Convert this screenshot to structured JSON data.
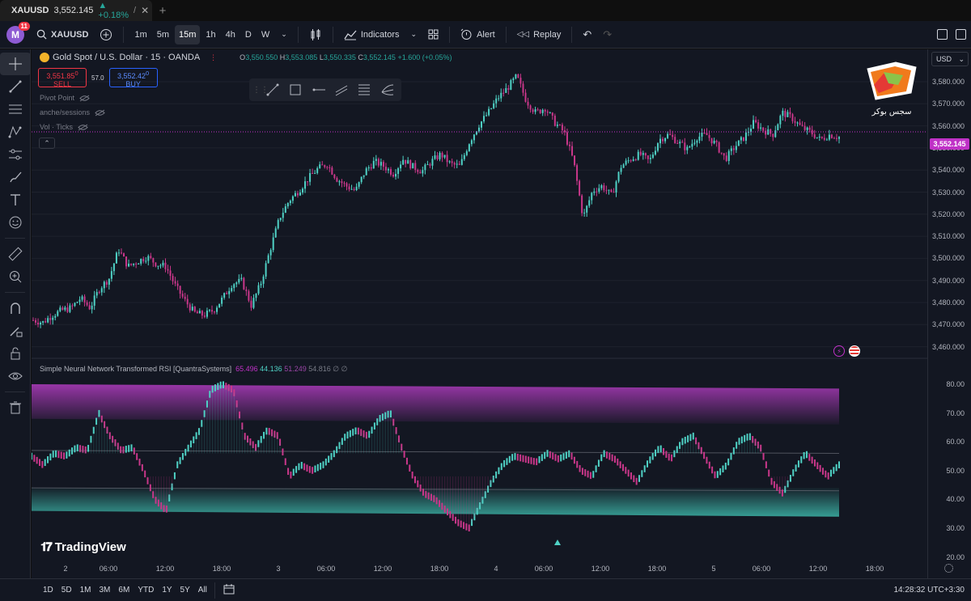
{
  "browser": {
    "tab_title": "XAUUSD",
    "tab_price": "3,552.145",
    "tab_change": "▲ +0.18%",
    "tab_suffix": "/"
  },
  "toolbar": {
    "avatar_letter": "M",
    "notification_count": "11",
    "symbol": "XAUUSD",
    "timeframes": [
      "1m",
      "5m",
      "15m",
      "1h",
      "4h",
      "D",
      "W"
    ],
    "active_timeframe": "15m",
    "indicators_label": "Indicators",
    "alert_label": "Alert",
    "replay_label": "Replay"
  },
  "legend": {
    "title": "Gold Spot / U.S. Dollar · 15 · OANDA",
    "open": "3,550.550",
    "high": "3,553.085",
    "low": "3,550.335",
    "close": "3,552.145",
    "change": "+1.600 (+0.05%)",
    "sell_price": "3,551.85",
    "sell_sup": "0",
    "sell_label": "SELL",
    "spread": "57.0",
    "buy_price": "3,552.42",
    "buy_sup": "0",
    "buy_label": "BUY",
    "indicators": [
      "Pivot Point",
      "anche/sessions",
      "Vol · Ticks"
    ]
  },
  "price_scale": {
    "currency": "USD",
    "labels": [
      "3,580.000",
      "3,570.000",
      "3,560.000",
      "3,550.000",
      "3,540.000",
      "3,530.000",
      "3,520.000",
      "3,510.000",
      "3,500.000",
      "3,490.000",
      "3,480.000",
      "3,470.000",
      "3,460.000"
    ],
    "current": "3,552.145"
  },
  "oscillator": {
    "title": "Simple Neural Network Transformed RSI [QuantraSystems]",
    "v1": "65.496",
    "v2": "44.136",
    "v3": "51.249",
    "v4": "54.816",
    "v5": "∅ ∅",
    "labels": [
      "80.00",
      "70.00",
      "60.00",
      "50.00",
      "40.00",
      "30.00",
      "20.00"
    ]
  },
  "time_axis": [
    "2",
    "06:00",
    "12:00",
    "18:00",
    "3",
    "06:00",
    "12:00",
    "18:00",
    "4",
    "06:00",
    "12:00",
    "18:00",
    "5",
    "06:00",
    "12:00",
    "18:00"
  ],
  "bottom": {
    "ranges": [
      "1D",
      "5D",
      "1M",
      "3M",
      "6M",
      "YTD",
      "1Y",
      "5Y",
      "All"
    ],
    "clock": "14:28:32 UTC+3:30"
  },
  "branding": {
    "tradingview": "TradingView",
    "watermark_text": "سجس بوکر"
  },
  "colors": {
    "bull": "#4fd1c5",
    "bear": "#c9378a",
    "accent": "#c032c7"
  },
  "chart_data": {
    "type": "candlestick",
    "series": [
      {
        "name": "XAUUSD",
        "close_path": [
          3475,
          3474,
          3477,
          3479,
          3480,
          3484,
          3480,
          3488,
          3492,
          3504,
          3497,
          3499,
          3501,
          3498,
          3497,
          3489,
          3483,
          3478,
          3477,
          3479,
          3484,
          3490,
          3491,
          3481,
          3490,
          3504,
          3517,
          3524,
          3528,
          3533,
          3537,
          3539,
          3533,
          3530,
          3528,
          3536,
          3540,
          3538,
          3535,
          3541,
          3538,
          3536,
          3540,
          3543,
          3539,
          3538,
          3548,
          3555,
          3560,
          3566,
          3570,
          3575,
          3565,
          3560,
          3562,
          3556,
          3552,
          3540,
          3517,
          3528,
          3530,
          3526,
          3538,
          3541,
          3543,
          3540,
          3549,
          3551,
          3548,
          3545,
          3550,
          3551,
          3547,
          3541,
          3546,
          3550,
          3556,
          3553,
          3551,
          3560,
          3558,
          3554,
          3552,
          3549,
          3551,
          3550
        ]
      }
    ],
    "ylim": [
      3460,
      3582
    ]
  }
}
